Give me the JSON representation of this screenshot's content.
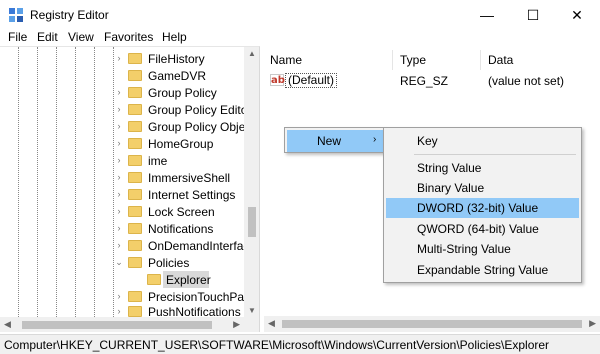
{
  "window": {
    "title": "Registry Editor",
    "buttons": {
      "minimize": "—",
      "maximize": "☐",
      "close": "✕"
    }
  },
  "menubar": [
    "File",
    "Edit",
    "View",
    "Favorites",
    "Help"
  ],
  "tree": {
    "items": [
      {
        "label": "FileHistory",
        "chevron": "›"
      },
      {
        "label": "GameDVR",
        "chevron": ""
      },
      {
        "label": "Group Policy",
        "chevron": "›"
      },
      {
        "label": "Group Policy Editor",
        "chevron": "›"
      },
      {
        "label": "Group Policy Objec",
        "chevron": "›"
      },
      {
        "label": "HomeGroup",
        "chevron": "›"
      },
      {
        "label": "ime",
        "chevron": "›"
      },
      {
        "label": "ImmersiveShell",
        "chevron": "›"
      },
      {
        "label": "Internet Settings",
        "chevron": "›"
      },
      {
        "label": "Lock Screen",
        "chevron": "›"
      },
      {
        "label": "Notifications",
        "chevron": "›"
      },
      {
        "label": "OnDemandInterfac",
        "chevron": "›"
      },
      {
        "label": "Policies",
        "chevron": "⌄"
      },
      {
        "label": "Explorer",
        "chevron": "",
        "child": true,
        "selected": true
      },
      {
        "label": "PrecisionTouchPad",
        "chevron": "›"
      },
      {
        "label": "PushNotifications",
        "chevron": "›"
      }
    ]
  },
  "values": {
    "columns": {
      "name": "Name",
      "type": "Type",
      "data": "Data"
    },
    "rows": [
      {
        "icon": "ab",
        "name": "(Default)",
        "type": "REG_SZ",
        "data": "(value not set)"
      }
    ]
  },
  "context_menu": {
    "main": {
      "label": "New",
      "arrow": "›"
    },
    "sub": {
      "key": "Key",
      "items": [
        "String Value",
        "Binary Value",
        "DWORD (32-bit) Value",
        "QWORD (64-bit) Value",
        "Multi-String Value",
        "Expandable String Value"
      ],
      "highlighted": "DWORD (32-bit) Value"
    }
  },
  "statusbar": {
    "path": "Computer\\HKEY_CURRENT_USER\\SOFTWARE\\Microsoft\\Windows\\CurrentVersion\\Policies\\Explorer"
  },
  "colors": {
    "highlight": "#91c9f7",
    "folder": "#f3cf6a",
    "menu_bg": "#f2f2f2"
  },
  "icons": {
    "app": "registry-editor-icon",
    "folder": "folder-icon",
    "value": "string-value-icon"
  }
}
